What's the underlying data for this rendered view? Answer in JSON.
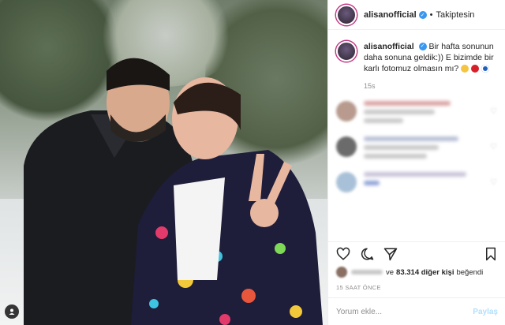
{
  "post": {
    "username": "alisanofficial",
    "follow_status": "Takiptesin",
    "caption": "Bir hafta sonunun daha sonuna geldik:)) E bizimde bir karlı fotomuz olmasın mı?",
    "caption_time": "15s",
    "likes_prefix": "ve",
    "likes_count": "83.314 diğer kişi",
    "likes_suffix": "beğendi",
    "time_ago": "15 SAAT ÖNCE",
    "comment_placeholder": "Yorum ekle...",
    "share_label": "Paylaş"
  },
  "colors": {
    "verified": "#3897f0",
    "share": "#b2dffc",
    "emoji_1": "#f5c542",
    "emoji_2": "#d8202a",
    "emoji_3": "#1f5fbf"
  },
  "icons": {
    "header_avatar": "avatar-icon",
    "verified": "verified-badge-icon",
    "like": "heart-icon",
    "comment": "comment-bubble-icon",
    "share": "paper-plane-icon",
    "save": "bookmark-icon",
    "photo_tag": "person-tag-icon"
  }
}
